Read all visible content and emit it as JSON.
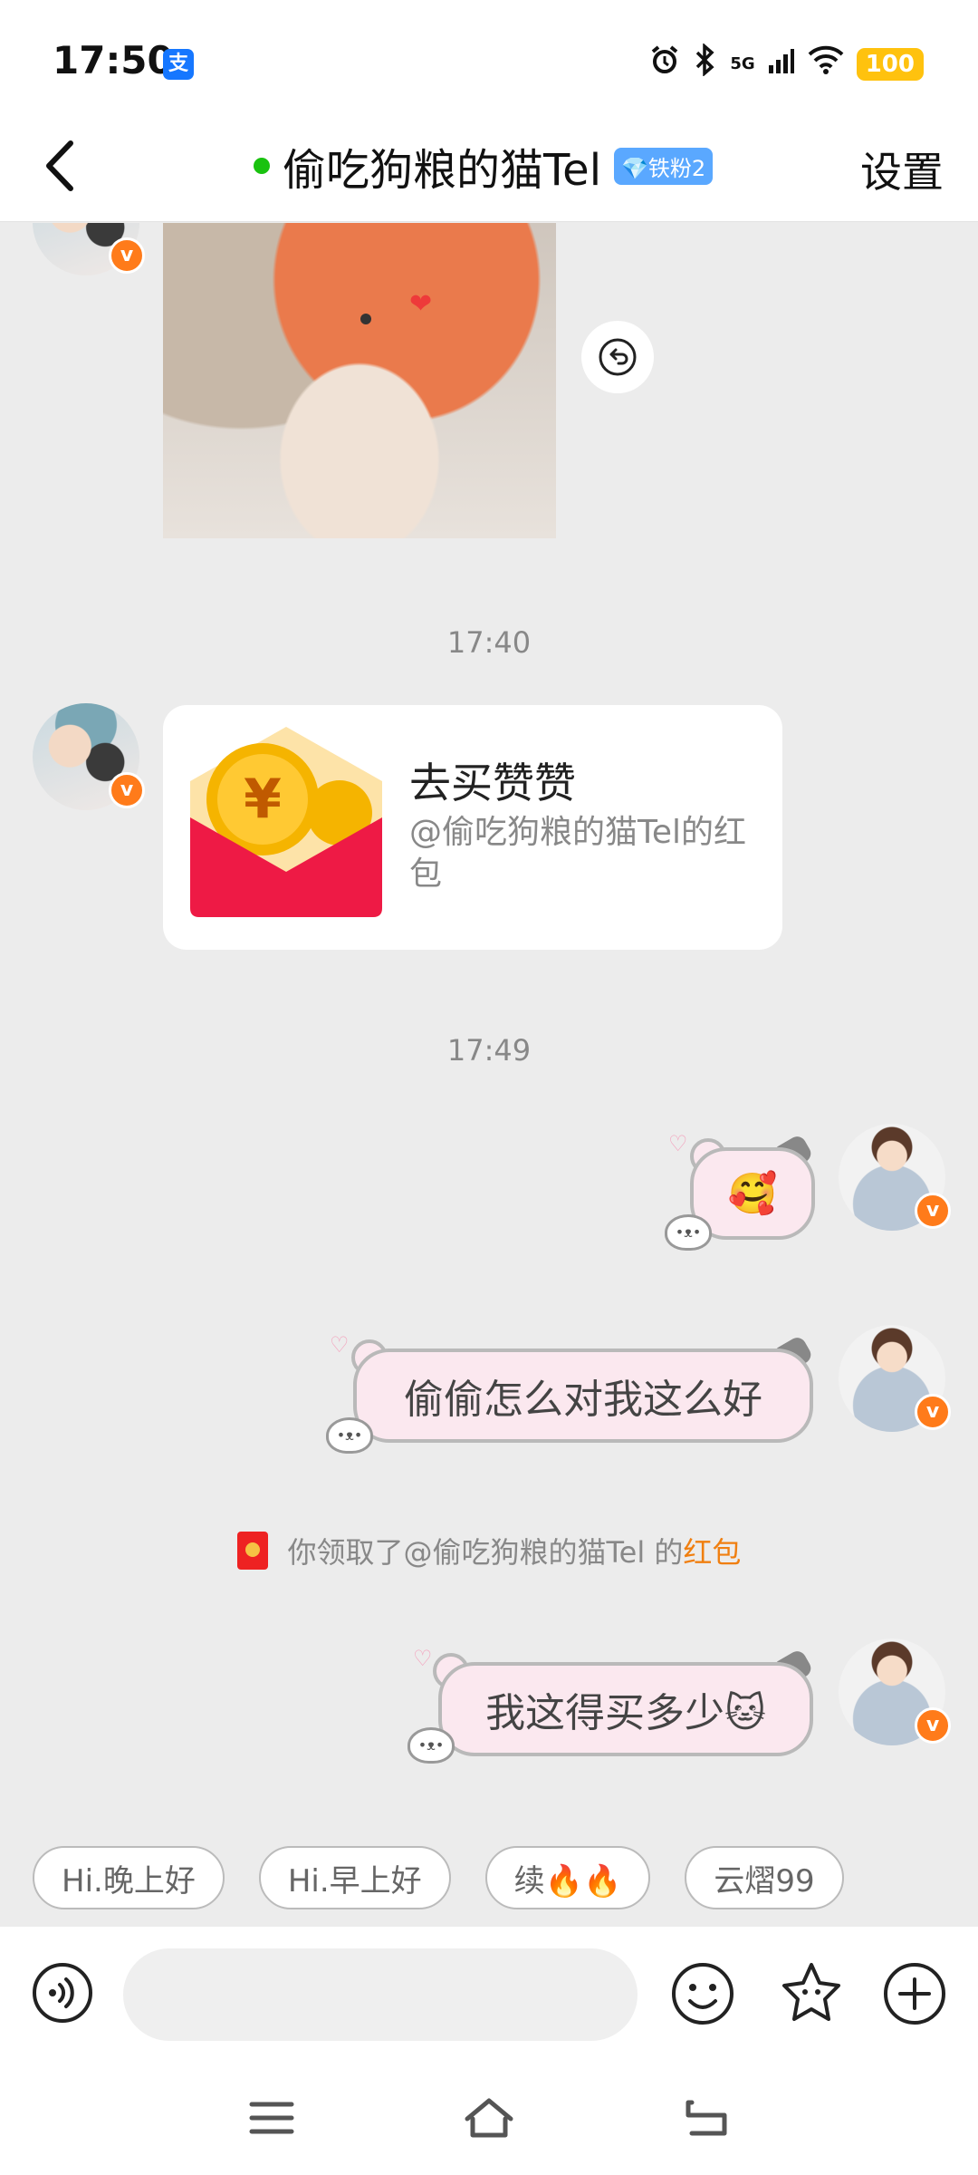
{
  "status_bar": {
    "time": "17:50",
    "alipay_icon": "支",
    "network": "5G",
    "battery": "100",
    "icons": [
      "alarm-icon",
      "bluetooth-icon",
      "signal-icon",
      "wifi-icon"
    ]
  },
  "header": {
    "title": "偷吃狗粮的猫Tel",
    "fan_badge": "💎铁粉2",
    "settings_label": "设置",
    "online_color": "#19c20f"
  },
  "chat": {
    "verified_mark": "v",
    "timestamps": [
      "17:40",
      "17:49"
    ],
    "red_packet_card": {
      "title": "去买赞赞",
      "subtitle": "@偷吃狗粮的猫Tel的红包"
    },
    "messages": [
      {
        "side": "right",
        "text": "🥰"
      },
      {
        "side": "right",
        "text": "偷偷怎么对我这么好"
      },
      {
        "side": "right",
        "text": "我这得买多少🐱"
      }
    ],
    "system_notice": {
      "prefix": "你领取了@偷吃狗粮的猫Tel 的",
      "link": "红包"
    }
  },
  "quick_replies": [
    "Hi.晚上好",
    "Hi.早上好",
    "续🔥🔥",
    "云熠99"
  ],
  "input": {
    "placeholder": ""
  },
  "accent_colors": {
    "red_packet_link": "#f07f10",
    "verified_badge": "#ff7b1a"
  }
}
